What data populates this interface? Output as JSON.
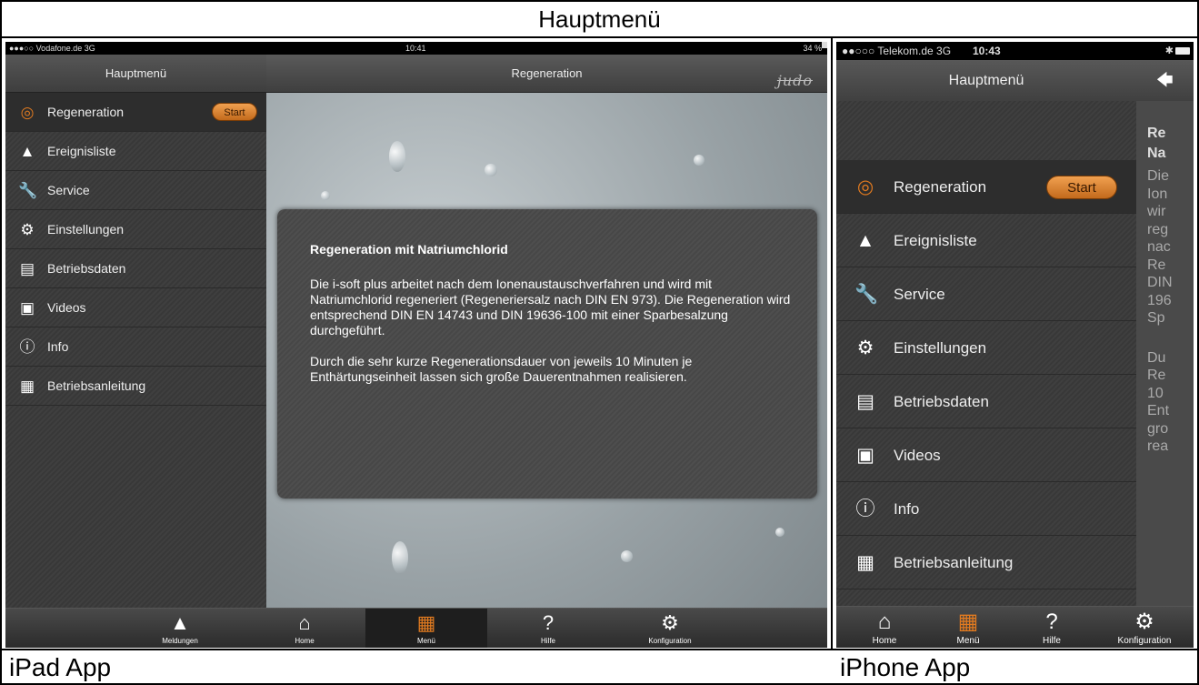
{
  "figure": {
    "title": "Hauptmenü",
    "caption_left": "iPad App",
    "caption_right": "iPhone App"
  },
  "ipad": {
    "status": {
      "carrier": "●●●○○ Vodafone.de  3G",
      "time": "10:41",
      "battery": "34 %"
    },
    "side_title": "Hauptmenü",
    "main_title": "Regeneration",
    "logo": "judo",
    "menu": [
      {
        "label": "Regeneration",
        "icon": "spiral-icon"
      },
      {
        "label": "Ereignisliste",
        "icon": "warning-triangle-icon"
      },
      {
        "label": "Service",
        "icon": "wrench-icon"
      },
      {
        "label": "Einstellungen",
        "icon": "gears-icon"
      },
      {
        "label": "Betriebsdaten",
        "icon": "document-icon"
      },
      {
        "label": "Videos",
        "icon": "camera-icon"
      },
      {
        "label": "Info",
        "icon": "info-icon"
      },
      {
        "label": "Betriebsanleitung",
        "icon": "manual-icon"
      }
    ],
    "start_label": "Start",
    "dialog": {
      "title": "Regeneration mit Natriumchlorid",
      "p1": "Die i-soft plus arbeitet nach dem Ionenaustauschverfahren und wird mit Natriumchlorid regeneriert (Regeneriersalz nach DIN EN 973). Die Regeneration wird entsprechend DIN EN 14743 und DIN 19636-100 mit einer Sparbesalzung durchgeführt.",
      "p2": "Durch die sehr kurze Regenerationsdauer von jeweils 10 Minuten je Enthärtungseinheit lassen sich große Dauerentnahmen realisieren."
    },
    "tabs": [
      {
        "label": "Meldungen",
        "icon": "warning-triangle-icon"
      },
      {
        "label": "Home",
        "icon": "home-icon"
      },
      {
        "label": "Menü",
        "icon": "grid-icon"
      },
      {
        "label": "Hilfe",
        "icon": "question-icon"
      },
      {
        "label": "Konfiguration",
        "icon": "gears-icon"
      }
    ]
  },
  "iphone": {
    "status": {
      "carrier": "●●○○○ Telekom.de  3G",
      "time": "10:43"
    },
    "title": "Hauptmenü",
    "menu": [
      {
        "label": "Regeneration",
        "icon": "spiral-icon"
      },
      {
        "label": "Ereignisliste",
        "icon": "warning-triangle-icon"
      },
      {
        "label": "Service",
        "icon": "wrench-icon"
      },
      {
        "label": "Einstellungen",
        "icon": "gears-icon"
      },
      {
        "label": "Betriebsdaten",
        "icon": "document-icon"
      },
      {
        "label": "Videos",
        "icon": "camera-icon"
      },
      {
        "label": "Info",
        "icon": "info-icon"
      },
      {
        "label": "Betriebsanleitung",
        "icon": "manual-icon"
      }
    ],
    "start_label": "Start",
    "peek_title": "Re Na",
    "peek_text_1": "Die Ion wir reg nac Re DIN 196 Sp",
    "peek_text_2": "Du Re 10 Ent gro rea",
    "tabs": [
      {
        "label": "Home",
        "icon": "home-icon"
      },
      {
        "label": "Menü",
        "icon": "grid-icon"
      },
      {
        "label": "Hilfe",
        "icon": "question-icon"
      },
      {
        "label": "Konfiguration",
        "icon": "gears-icon"
      }
    ]
  }
}
